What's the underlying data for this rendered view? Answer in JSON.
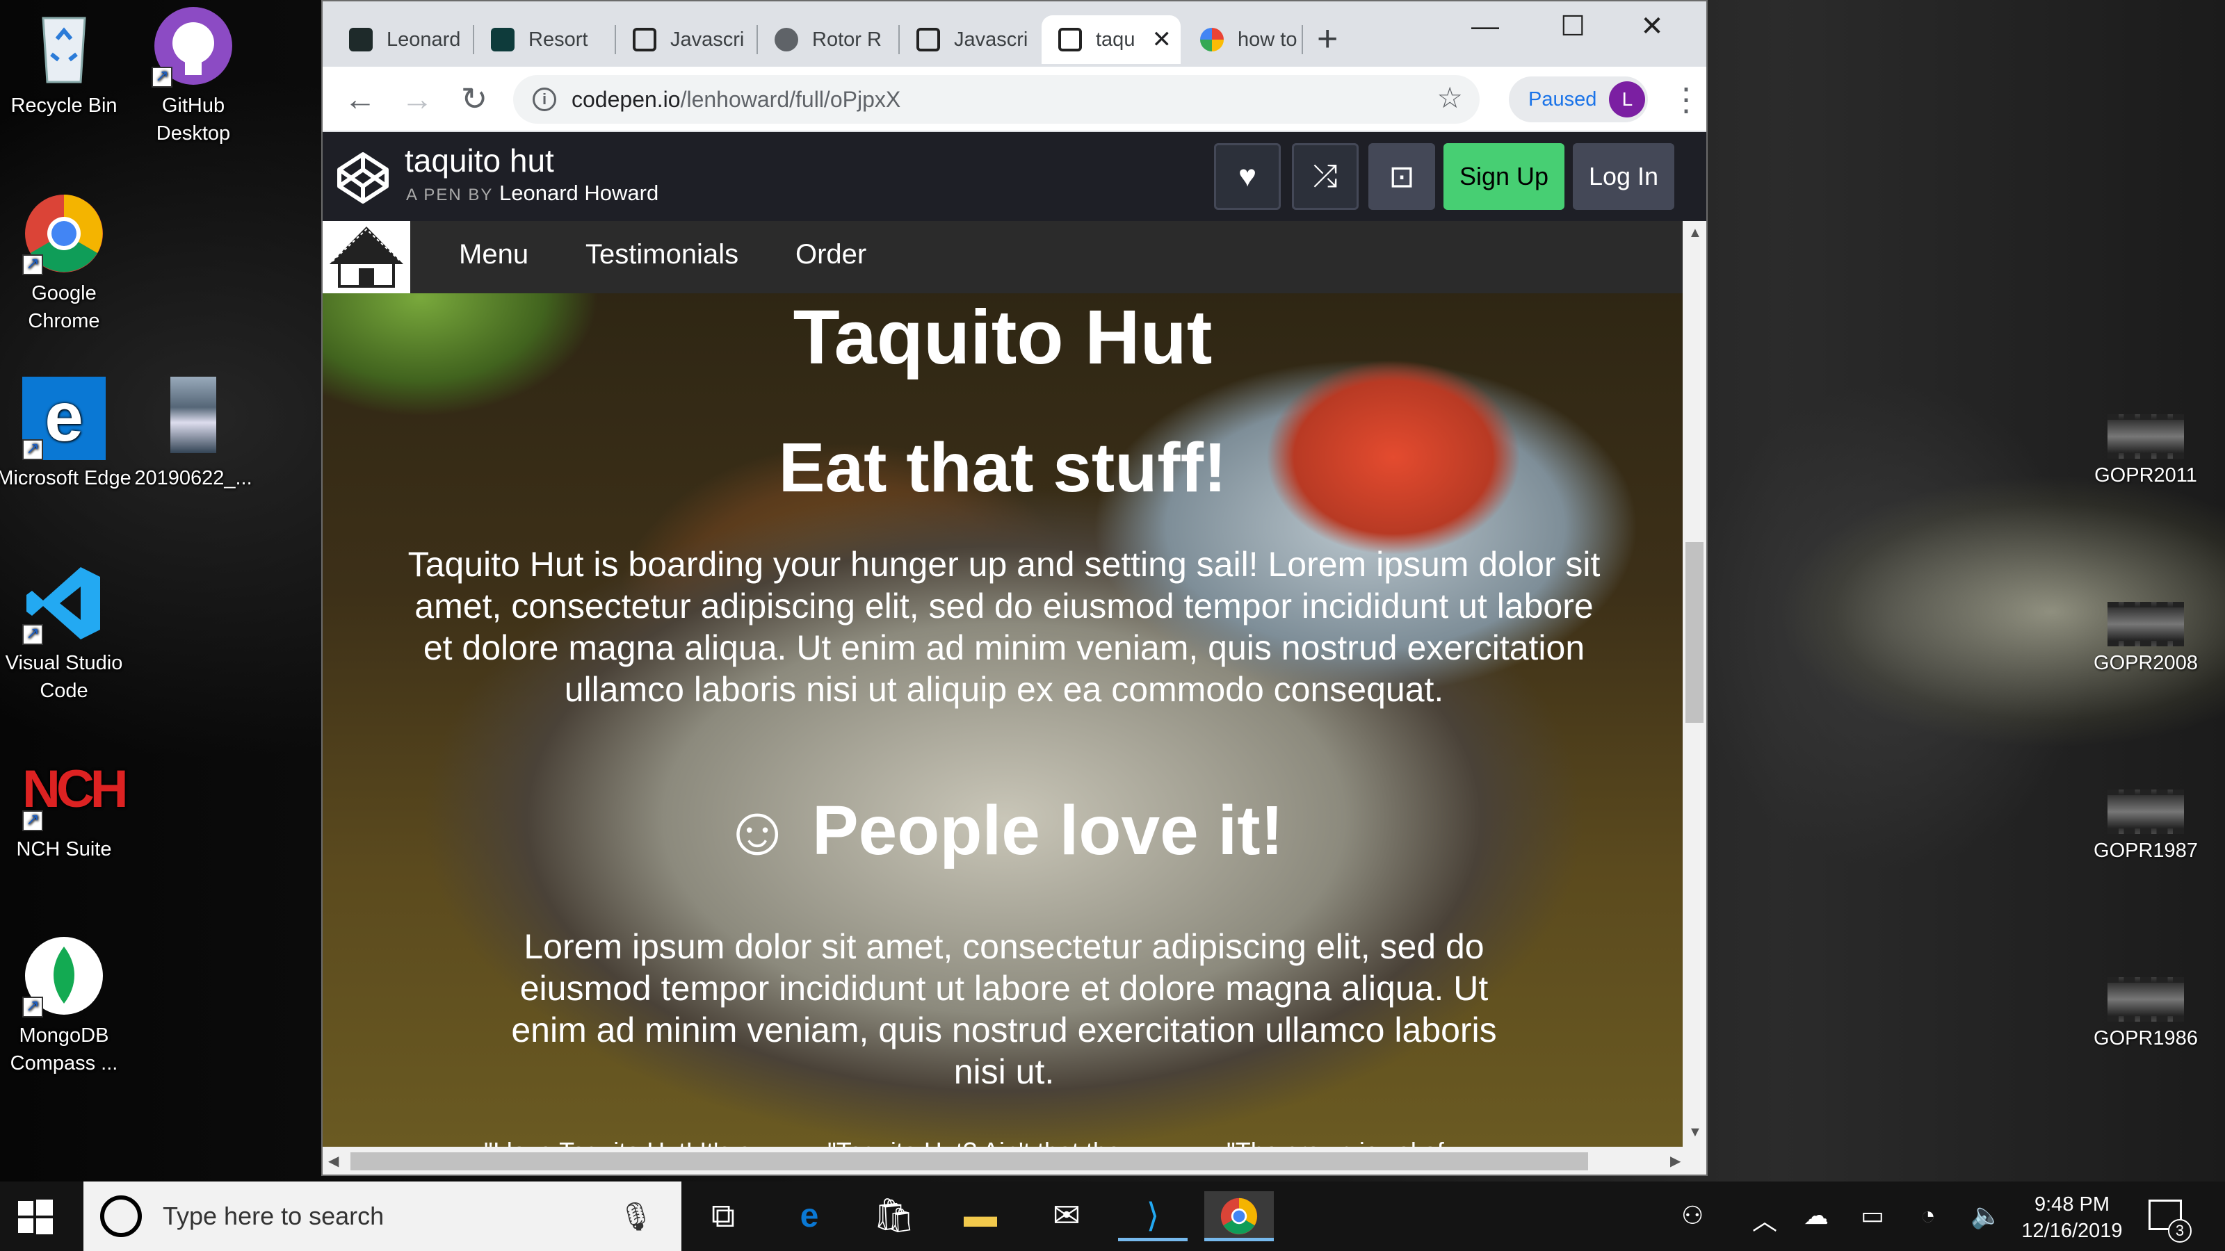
{
  "desktop": {
    "icons": [
      {
        "label": "Recycle Bin",
        "icon": "recycle-bin-icon"
      },
      {
        "label": "GitHub Desktop",
        "icon": "github-icon"
      },
      {
        "label": "Google Chrome",
        "icon": "chrome-icon"
      },
      {
        "label": "Microsoft Edge",
        "icon": "edge-icon"
      },
      {
        "label": "20190622_...",
        "icon": "image-file-icon"
      },
      {
        "label": "Visual Studio Code",
        "icon": "vscode-icon"
      },
      {
        "label": "NCH Suite",
        "icon": "nch-icon"
      },
      {
        "label": "MongoDB Compass ...",
        "icon": "mongodb-icon"
      }
    ],
    "files": [
      {
        "label": "GOPR2011"
      },
      {
        "label": "GOPR2008"
      },
      {
        "label": "GOPR1987"
      },
      {
        "label": "GOPR1986"
      }
    ]
  },
  "browser": {
    "tabs": [
      {
        "label": "Leonard",
        "icon": "codepen-icon",
        "active": false
      },
      {
        "label": "Resort",
        "icon": "codepen-icon",
        "active": false
      },
      {
        "label": "Javascri",
        "icon": "codepen-icon",
        "active": false
      },
      {
        "label": "Rotor R",
        "icon": "globe-icon",
        "active": false
      },
      {
        "label": "Javascri",
        "icon": "codepen-icon",
        "active": false
      },
      {
        "label": "taqu",
        "icon": "codepen-icon",
        "active": true
      },
      {
        "label": "how to",
        "icon": "google-icon",
        "active": false
      }
    ],
    "url_host": "codepen.io",
    "url_path": "/lenhoward/full/oPjpxX",
    "profile_status": "Paused",
    "profile_initial": "L"
  },
  "codepen": {
    "title": "taquito hut",
    "byline_prefix": "A PEN BY",
    "author": "Leonard Howard",
    "signup_label": "Sign Up",
    "login_label": "Log In"
  },
  "page": {
    "nav": [
      "Menu",
      "Testimonials",
      "Order"
    ],
    "heading": "Taquito Hut",
    "subheading": "Eat that stuff!",
    "intro": "Taquito Hut is boarding your hunger up and setting sail! Lorem ipsum dolor sit amet, consectetur adipiscing elit, sed do eiusmod tempor incididunt ut labore et dolore magna aliqua. Ut enim ad minim veniam, quis nostrud exercitation ullamco laboris nisi ut aliquip ex ea commodo consequat.",
    "testimonials_heading": "☺ People love it!",
    "testimonials_text": "Lorem ipsum dolor sit amet, consectetur adipiscing elit, sed do eiusmod tempor incididunt ut labore et dolore magna aliqua. Ut enim ad minim veniam, quis nostrud exercitation ullamco laboris nisi ut.",
    "quotes": [
      "\"I love Taquito Hut! It's a",
      "\"Taquito Hut? Ain't that the",
      "\"The crown jewel of"
    ]
  },
  "taskbar": {
    "search_placeholder": "Type here to search",
    "time": "9:48 PM",
    "date": "12/16/2019",
    "notification_count": "3"
  }
}
